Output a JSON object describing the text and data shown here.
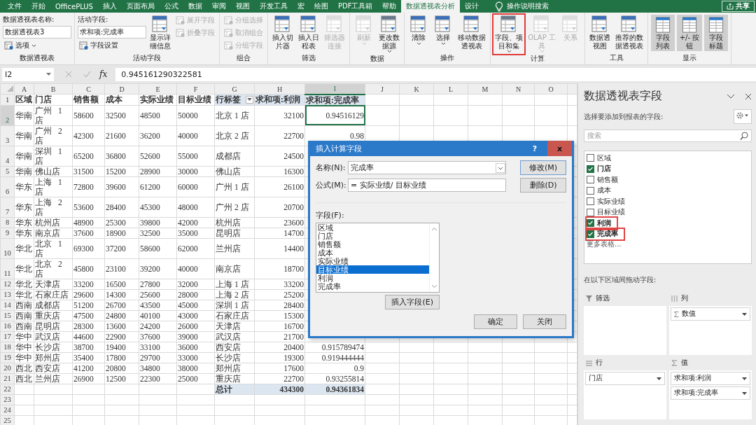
{
  "menu_tabs": [
    {
      "label": "文件",
      "selected": false
    },
    {
      "label": "开始",
      "selected": false
    },
    {
      "label": "OfficePLUS",
      "selected": false
    },
    {
      "label": "插入",
      "selected": false
    },
    {
      "label": "页面布局",
      "selected": false
    },
    {
      "label": "公式",
      "selected": false
    },
    {
      "label": "数据",
      "selected": false
    },
    {
      "label": "审阅",
      "selected": false
    },
    {
      "label": "视图",
      "selected": false
    },
    {
      "label": "开发工具",
      "selected": false
    },
    {
      "label": "宏",
      "selected": false
    },
    {
      "label": "绘图",
      "selected": false
    },
    {
      "label": "PDF工具箱",
      "selected": false
    },
    {
      "label": "帮助",
      "selected": false
    },
    {
      "label": "数据透视表分析",
      "selected": true
    },
    {
      "label": "设计",
      "selected": false
    }
  ],
  "search_hint": "操作说明搜索",
  "share_button": "共享",
  "ribbon_groups": [
    {
      "label": "数据透视表",
      "columns": [
        [
          {
            "kind": "caption",
            "label": "数据透视表名称:"
          },
          {
            "kind": "field",
            "value": "数据透视表3"
          },
          {
            "kind": "small",
            "label": "选项",
            "disabled": false,
            "dropdown": true
          }
        ]
      ]
    },
    {
      "label": "活动字段",
      "columns": [
        [
          {
            "kind": "caption",
            "label": "活动字段:"
          },
          {
            "kind": "field",
            "value": "求和项:完成率"
          },
          {
            "kind": "small",
            "label": "字段设置",
            "disabled": false,
            "dropdown": false
          }
        ],
        [
          {
            "kind": "big",
            "label": "显示详细信息",
            "disabled": false,
            "dropdown": false,
            "highlighted": false
          }
        ],
        [
          {
            "kind": "small",
            "label": "展开字段",
            "disabled": true,
            "dropdown": false
          },
          {
            "kind": "small",
            "label": "折叠字段",
            "disabled": true,
            "dropdown": false
          }
        ]
      ]
    },
    {
      "label": "组合",
      "columns": [
        [
          {
            "kind": "small",
            "label": "分组选择",
            "disabled": true,
            "dropdown": false
          },
          {
            "kind": "small",
            "label": "取消组合",
            "disabled": true,
            "dropdown": false
          },
          {
            "kind": "small",
            "label": "分组字段",
            "disabled": true,
            "dropdown": false
          }
        ]
      ]
    },
    {
      "label": "筛选",
      "columns": [
        [
          {
            "kind": "big",
            "label": "插入切片器",
            "disabled": false,
            "dropdown": false,
            "highlighted": false
          }
        ],
        [
          {
            "kind": "big",
            "label": "插入日程表",
            "disabled": false,
            "dropdown": false,
            "highlighted": false
          }
        ],
        [
          {
            "kind": "big",
            "label": "筛选器连接",
            "disabled": true,
            "dropdown": false,
            "highlighted": false
          }
        ]
      ]
    },
    {
      "label": "数据",
      "columns": [
        [
          {
            "kind": "big",
            "label": "刷新",
            "disabled": true,
            "dropdown": true,
            "highlighted": false
          }
        ],
        [
          {
            "kind": "big",
            "label": "更改数据源",
            "disabled": false,
            "dropdown": true,
            "highlighted": false
          }
        ]
      ]
    },
    {
      "label": "操作",
      "columns": [
        [
          {
            "kind": "big",
            "label": "清除",
            "disabled": false,
            "dropdown": true,
            "highlighted": false
          }
        ],
        [
          {
            "kind": "big",
            "label": "选择",
            "disabled": false,
            "dropdown": true,
            "highlighted": false
          }
        ],
        [
          {
            "kind": "big",
            "label": "移动数据透视表",
            "disabled": false,
            "dropdown": false,
            "highlighted": false
          }
        ]
      ]
    },
    {
      "label": "计算",
      "columns": [
        [
          {
            "kind": "big",
            "label": "字段、项目和集",
            "disabled": false,
            "dropdown": true,
            "highlighted": true
          }
        ],
        [
          {
            "kind": "big",
            "label": "OLAP 工具",
            "disabled": true,
            "dropdown": true,
            "highlighted": false
          }
        ],
        [
          {
            "kind": "big",
            "label": "关系",
            "disabled": true,
            "dropdown": false,
            "highlighted": false
          }
        ]
      ]
    },
    {
      "label": "工具",
      "columns": [
        [
          {
            "kind": "big",
            "label": "数据透视图",
            "disabled": false,
            "dropdown": false,
            "highlighted": false
          }
        ],
        [
          {
            "kind": "big",
            "label": "推荐的数据透视表",
            "disabled": false,
            "dropdown": false,
            "highlighted": false
          }
        ]
      ]
    },
    {
      "label": "显示",
      "columns": [
        [
          {
            "kind": "toggle",
            "label": "字段列表",
            "on": true
          }
        ],
        [
          {
            "kind": "toggle",
            "label": "+/- 按钮",
            "on": true
          }
        ],
        [
          {
            "kind": "toggle",
            "label": "字段标题",
            "on": true
          }
        ]
      ]
    }
  ],
  "formula_bar": {
    "name_box": "I2",
    "fx_button": "fx",
    "value": "0.945161290322581"
  },
  "sheet": {
    "columns": [
      {
        "label": "A",
        "selected": false
      },
      {
        "label": "B",
        "selected": false
      },
      {
        "label": "C",
        "selected": false
      },
      {
        "label": "D",
        "selected": false
      },
      {
        "label": "E",
        "selected": false
      },
      {
        "label": "F",
        "selected": false
      },
      {
        "label": "G",
        "selected": false
      },
      {
        "label": "H",
        "selected": false
      },
      {
        "label": "I",
        "selected": true
      },
      {
        "label": "J",
        "selected": false
      },
      {
        "label": "K",
        "selected": false
      },
      {
        "label": "L",
        "selected": false
      },
      {
        "label": "M",
        "selected": false
      },
      {
        "label": "N",
        "selected": false
      },
      {
        "label": "O",
        "selected": false
      }
    ],
    "rows": [
      {
        "number": "1",
        "selected": false,
        "kind": "header",
        "cells": [
          "区域",
          "门店",
          "销售额",
          "成本",
          "实际业绩",
          "目标业绩"
        ],
        "pivot": [
          "行标签",
          "求和项:利润",
          "求和项:完成率"
        ]
      },
      {
        "number": "2",
        "selected": true,
        "kind": "data",
        "cells": [
          "华南",
          "广州 1 店",
          "58600",
          "32500",
          "48500",
          "50000"
        ],
        "pivot": [
          "北京 1 店",
          "32100",
          "0.94516129"
        ]
      },
      {
        "number": "3",
        "selected": false,
        "kind": "data",
        "cells": [
          "华南",
          "广州 2 店",
          "42300",
          "21600",
          "36200",
          "40000"
        ],
        "pivot": [
          "北京 2 店",
          "22700",
          "0.98"
        ]
      },
      {
        "number": "4",
        "selected": false,
        "kind": "data",
        "cells": [
          "华南",
          "深圳 1 店",
          "65200",
          "36800",
          "52600",
          "55000"
        ],
        "pivot": [
          "成都店",
          "24500"
        ]
      },
      {
        "number": "5",
        "selected": false,
        "kind": "data",
        "cells": [
          "华南",
          "佛山店",
          "31500",
          "15200",
          "28900",
          "30000"
        ],
        "pivot": [
          "佛山店",
          "16300"
        ]
      },
      {
        "number": "6",
        "selected": false,
        "kind": "data",
        "cells": [
          "华东",
          "上海 1 店",
          "72800",
          "39600",
          "61200",
          "60000"
        ],
        "pivot": [
          "广州 1 店",
          "26100"
        ]
      },
      {
        "number": "7",
        "selected": false,
        "kind": "data",
        "cells": [
          "华东",
          "上海 2 店",
          "53600",
          "28400",
          "45300",
          "48000"
        ],
        "pivot": [
          "广州 2 店",
          "20700"
        ]
      },
      {
        "number": "8",
        "selected": false,
        "kind": "data",
        "cells": [
          "华东",
          "杭州店",
          "48900",
          "25300",
          "39800",
          "42000"
        ],
        "pivot": [
          "杭州店",
          "23600"
        ]
      },
      {
        "number": "9",
        "selected": false,
        "kind": "data",
        "cells": [
          "华东",
          "南京店",
          "37600",
          "18900",
          "32500",
          "35000"
        ],
        "pivot": [
          "昆明店",
          "14700"
        ]
      },
      {
        "number": "10",
        "selected": false,
        "kind": "data",
        "cells": [
          "华北",
          "北京 1 店",
          "69300",
          "37200",
          "58600",
          "62000"
        ],
        "pivot": [
          "兰州店",
          "14400"
        ]
      },
      {
        "number": "11",
        "selected": false,
        "kind": "data",
        "cells": [
          "华北",
          "北京 2 店",
          "45800",
          "23100",
          "39200",
          "40000"
        ],
        "pivot": [
          "南京店",
          "18700"
        ]
      },
      {
        "number": "12",
        "selected": false,
        "kind": "data",
        "cells": [
          "华北",
          "天津店",
          "33200",
          "16500",
          "27800",
          "32000"
        ],
        "pivot": [
          "上海 1 店",
          "33200"
        ]
      },
      {
        "number": "13",
        "selected": false,
        "kind": "data",
        "cells": [
          "华北",
          "石家庄店",
          "29600",
          "14300",
          "25600",
          "28000"
        ],
        "pivot": [
          "上海 2 店",
          "25200"
        ]
      },
      {
        "number": "14",
        "selected": false,
        "kind": "data",
        "cells": [
          "西南",
          "成都店",
          "51200",
          "26700",
          "43500",
          "45000"
        ],
        "pivot": [
          "深圳 1 店",
          "28400"
        ]
      },
      {
        "number": "15",
        "selected": false,
        "kind": "data",
        "cells": [
          "西南",
          "重庆店",
          "47500",
          "24800",
          "40100",
          "43000"
        ],
        "pivot": [
          "石家庄店",
          "15300"
        ]
      },
      {
        "number": "16",
        "selected": false,
        "kind": "data",
        "cells": [
          "西南",
          "昆明店",
          "28300",
          "13600",
          "24200",
          "26000"
        ],
        "pivot": [
          "天津店",
          "16700"
        ]
      },
      {
        "number": "17",
        "selected": false,
        "kind": "data",
        "cells": [
          "华中",
          "武汉店",
          "44600",
          "22900",
          "37600",
          "39000"
        ],
        "pivot": [
          "武汉店",
          "21700"
        ]
      },
      {
        "number": "18",
        "selected": false,
        "kind": "data",
        "cells": [
          "华中",
          "长沙店",
          "38700",
          "19400",
          "33100",
          "36000"
        ],
        "pivot": [
          "西安店",
          "20400",
          "0.915789474"
        ]
      },
      {
        "number": "19",
        "selected": false,
        "kind": "data",
        "cells": [
          "华中",
          "郑州店",
          "35400",
          "17800",
          "29700",
          "33000"
        ],
        "pivot": [
          "长沙店",
          "19300",
          "0.919444444"
        ]
      },
      {
        "number": "20",
        "selected": false,
        "kind": "data",
        "cells": [
          "西北",
          "西安店",
          "41200",
          "20800",
          "34800",
          "38000"
        ],
        "pivot": [
          "郑州店",
          "17600",
          "0.9"
        ]
      },
      {
        "number": "21",
        "selected": false,
        "kind": "data",
        "cells": [
          "西北",
          "兰州店",
          "26900",
          "12500",
          "22300",
          "25000"
        ],
        "pivot": [
          "重庆店",
          "22700",
          "0.93255814"
        ]
      },
      {
        "number": "22",
        "selected": false,
        "kind": "total",
        "pivot": [
          "总计",
          "434300",
          "0.94361834"
        ]
      },
      {
        "number": "23",
        "selected": false,
        "kind": "empty"
      },
      {
        "number": "24",
        "selected": false,
        "kind": "empty"
      },
      {
        "number": "25",
        "selected": false,
        "kind": "empty"
      }
    ]
  },
  "dialog": {
    "title": "插入计算字段",
    "help_button": "?",
    "close_button": "x",
    "name_label": "名称(N):",
    "name_value": "完成率",
    "formula_label": "公式(M):",
    "formula_value": "= 实际业绩/ 目标业绩",
    "modify_button": "修改(M)",
    "delete_button": "删除(D)",
    "fields_label": "字段(F):",
    "fields": [
      {
        "label": "区域",
        "selected": false
      },
      {
        "label": "门店",
        "selected": false
      },
      {
        "label": "销售额",
        "selected": false
      },
      {
        "label": "成本",
        "selected": false
      },
      {
        "label": "实际业绩",
        "selected": false
      },
      {
        "label": "目标业绩",
        "selected": true
      },
      {
        "label": "利润",
        "selected": false
      },
      {
        "label": "完成率",
        "selected": false
      }
    ],
    "insert_button": "插入字段(E)",
    "ok_button": "确定",
    "cancel_button": "关闭"
  },
  "field_pane": {
    "title": "数据透视表字段",
    "prompt": "选择要添加到报表的字段:",
    "search_placeholder": "搜索",
    "fields": [
      {
        "label": "区域",
        "checked": false,
        "highlighted": false
      },
      {
        "label": "门店",
        "checked": true,
        "highlighted": false
      },
      {
        "label": "销售额",
        "checked": false,
        "highlighted": false
      },
      {
        "label": "成本",
        "checked": false,
        "highlighted": false
      },
      {
        "label": "实际业绩",
        "checked": false,
        "highlighted": false
      },
      {
        "label": "目标业绩",
        "checked": false,
        "highlighted": false
      },
      {
        "label": "利润",
        "checked": true,
        "highlighted": true
      },
      {
        "label": "完成率",
        "checked": true,
        "highlighted": true
      }
    ],
    "more_tables": "更多表格...",
    "areas_prompt": "在以下区域间拖动字段:",
    "areas": [
      {
        "kind": "filter",
        "label": "筛选"
      },
      {
        "kind": "columns",
        "label": "列",
        "items": [
          "数值"
        ]
      },
      {
        "kind": "rows",
        "label": "行",
        "items": [
          "门店"
        ]
      },
      {
        "kind": "values",
        "label": "值",
        "items": [
          "求和项:利润",
          "求和项:完成率"
        ]
      }
    ]
  }
}
